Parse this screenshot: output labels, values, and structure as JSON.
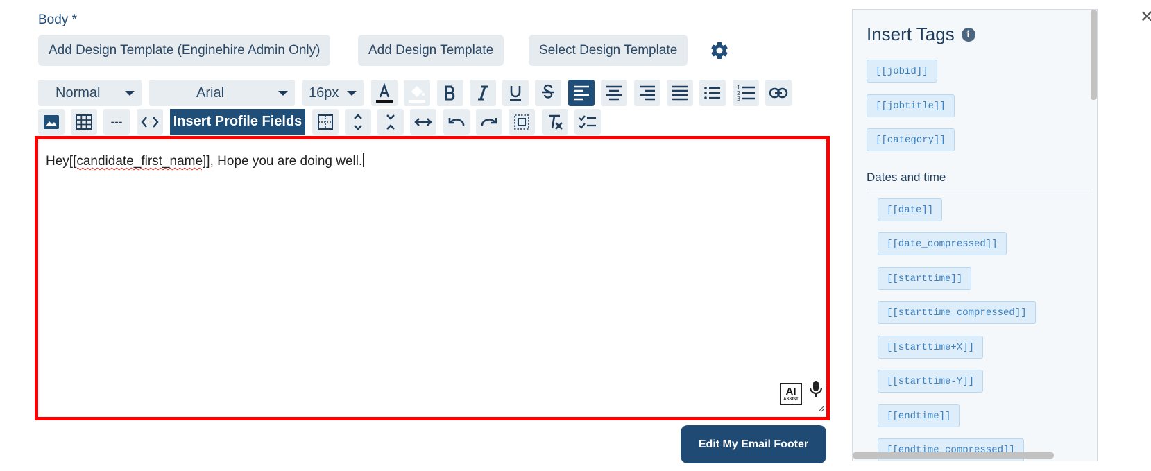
{
  "form": {
    "body_label": "Body *",
    "template_buttons": [
      "Add Design Template (Enginehire Admin Only)",
      "Add Design Template",
      "Select Design Template"
    ]
  },
  "toolbar": {
    "style_value": "Normal",
    "font_value": "Arial",
    "size_value": "16px",
    "insert_profile_label": "Insert Profile Fields",
    "divider_glyph": "---"
  },
  "editor": {
    "text_before": "Hey",
    "tag_text": "[[candidate_first_name]]",
    "text_after": ", Hope you are doing well.",
    "ai_label": "AI",
    "ai_sub_label": "ASSIST"
  },
  "footer_button": "Edit My Email Footer",
  "tags_panel": {
    "title": "Insert Tags",
    "general_tags": [
      "[[jobid]]",
      "[[jobtitle]]",
      "[[category]]"
    ],
    "dates_heading": "Dates and time",
    "date_tags": [
      "[[date]]",
      "[[date_compressed]]",
      "[[starttime]]",
      "[[starttime_compressed]]",
      "[[starttime+X]]",
      "[[starttime-Y]]",
      "[[endtime]]",
      "[[endtime_compressed]]"
    ]
  },
  "colors": {
    "accent": "#1f4e79",
    "highlight_border": "#ff0000",
    "tag_text": "#3a7fc0"
  },
  "icons": [
    "gear-icon",
    "font-color-icon",
    "highlight-icon",
    "bold-icon",
    "italic-icon",
    "underline-icon",
    "strikethrough-icon",
    "align-left-icon",
    "align-center-icon",
    "align-right-icon",
    "align-justify-icon",
    "bullet-list-icon",
    "numbered-list-icon",
    "link-icon",
    "image-icon",
    "table-icon",
    "code-icon",
    "page-break-icon",
    "expand-vertical-icon",
    "collapse-vertical-icon",
    "expand-horizontal-icon",
    "undo-icon",
    "redo-icon",
    "select-all-icon",
    "clear-format-icon",
    "checklist-icon",
    "microphone-icon",
    "info-icon",
    "close-icon"
  ]
}
